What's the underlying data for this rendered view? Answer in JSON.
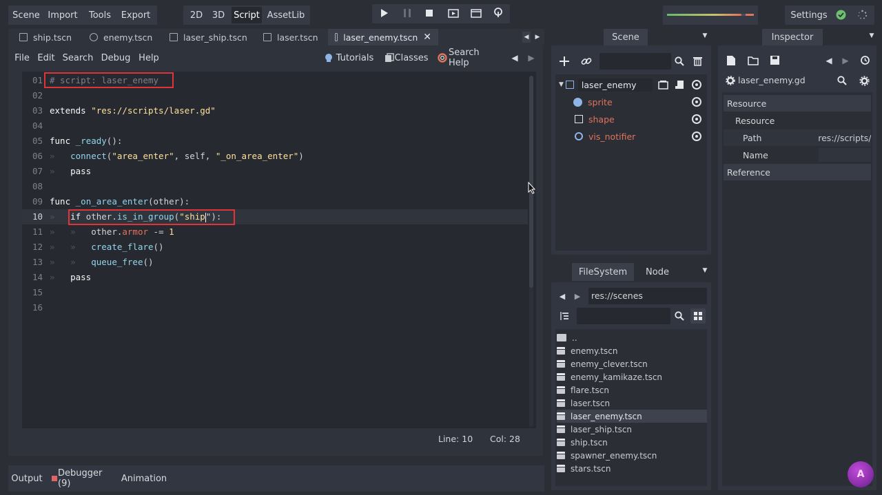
{
  "menu": {
    "scene": "Scene",
    "import": "Import",
    "tools": "Tools",
    "export": "Export"
  },
  "modes": {
    "m2d": "2D",
    "m3d": "3D",
    "script": "Script",
    "assetlib": "AssetLib"
  },
  "settings": "Settings",
  "scene_tabs": [
    {
      "label": "ship.tscn"
    },
    {
      "label": "enemy.tscn"
    },
    {
      "label": "laser_ship.tscn"
    },
    {
      "label": "laser.tscn"
    },
    {
      "label": "laser_enemy.tscn"
    }
  ],
  "script_menu": {
    "file": "File",
    "edit": "Edit",
    "search": "Search",
    "debug": "Debug",
    "help": "Help",
    "tutorials": "Tutorials",
    "classes": "Classes",
    "search_help": "Search Help"
  },
  "code": {
    "line_numbers": [
      "01",
      "02",
      "03",
      "04",
      "05",
      "06",
      "07",
      "08",
      "09",
      "10",
      "11",
      "12",
      "13",
      "14",
      "15",
      "16"
    ],
    "l1": "# script: laser_enemy",
    "l3a": "extends",
    "l3b": "\"res://scripts/laser.gd\"",
    "l5a": "func",
    "l5b": "_ready",
    "l5c": "():",
    "l6a": "connect",
    "l6b": "(",
    "l6c": "\"area_enter\"",
    "l6d": ", self, ",
    "l6e": "\"_on_area_enter\"",
    "l6f": ")",
    "l7": "pass",
    "l9a": "func",
    "l9b": "_on_area_enter",
    "l9c": "(other):",
    "l10a": "if",
    "l10b": " other.",
    "l10c": "is_in_group",
    "l10d": "(",
    "l10e": "\"ship",
    "l10f": "\"):",
    "l11a": "other.",
    "l11b": "armor",
    "l11c": " -= ",
    "l11d": "1",
    "l12a": "create_flare",
    "l12b": "()",
    "l13a": "queue_free",
    "l13b": "()",
    "l14": "pass",
    "tab_glyph": "»"
  },
  "status": {
    "line": "Line: 10",
    "col": "Col: 28"
  },
  "bottom": {
    "output": "Output",
    "debugger": "Debugger (9)",
    "animation": "Animation"
  },
  "scene_dock": {
    "tab": "Scene",
    "nodes": [
      {
        "label": "laser_enemy"
      },
      {
        "label": "sprite"
      },
      {
        "label": "shape"
      },
      {
        "label": "vis_notifier"
      }
    ]
  },
  "inspector": {
    "tab": "Inspector",
    "file": "laser_enemy.gd",
    "section": "Resource",
    "sub": "Resource",
    "path_label": "Path",
    "path_value": "res://scripts/",
    "name_label": "Name",
    "reference": "Reference"
  },
  "filesystem": {
    "tab": "FileSystem",
    "node_tab": "Node",
    "path": "res://scenes",
    "files": [
      "..",
      "enemy.tscn",
      "enemy_clever.tscn",
      "enemy_kamikaze.tscn",
      "flare.tscn",
      "laser.tscn",
      "laser_enemy.tscn",
      "laser_ship.tscn",
      "ship.tscn",
      "spawner_enemy.tscn",
      "stars.tscn"
    ],
    "selected": "laser_enemy.tscn"
  },
  "colors": {
    "accent": "#5f8dd3",
    "node_orange": "#e0745c",
    "highlight_box": "#e0333a"
  }
}
